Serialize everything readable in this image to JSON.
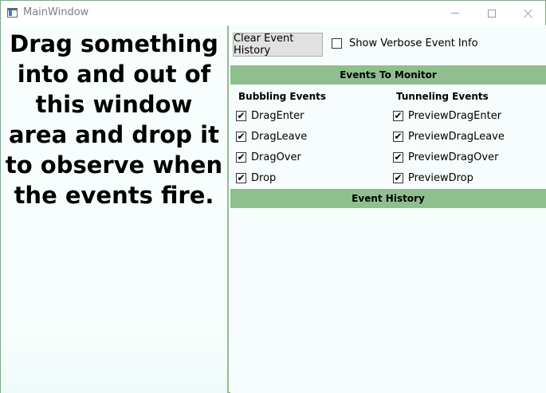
{
  "window": {
    "title": "MainWindow"
  },
  "left_panel": {
    "instructions": "Drag something into and out of this window area and drop it to observe when the events fire."
  },
  "toolbar": {
    "clear_label": "Clear Event History",
    "verbose_label": "Show Verbose Event Info",
    "verbose_checked": false
  },
  "monitor": {
    "header": "Events To Monitor",
    "bubbling_title": "Bubbling Events",
    "tunneling_title": "Tunneling Events",
    "bubbling": [
      {
        "label": "DragEnter",
        "checked": true
      },
      {
        "label": "DragLeave",
        "checked": true
      },
      {
        "label": "DragOver",
        "checked": true
      },
      {
        "label": "Drop",
        "checked": true
      }
    ],
    "tunneling": [
      {
        "label": "PreviewDragEnter",
        "checked": true
      },
      {
        "label": "PreviewDragLeave",
        "checked": true
      },
      {
        "label": "PreviewDragOver",
        "checked": true
      },
      {
        "label": "PreviewDrop",
        "checked": true
      }
    ]
  },
  "history": {
    "header": "Event History",
    "entries": []
  },
  "colors": {
    "section_header": "#8fbf8f",
    "panel_background": "#f7fcfc",
    "button_face": "#e1e1e1"
  }
}
